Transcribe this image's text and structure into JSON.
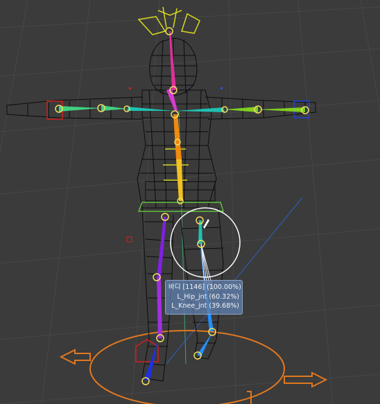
{
  "viewport": {
    "background": "#3b3b3b",
    "grid_color": "#4a4a4a",
    "mesh_color": "#0b0b0b"
  },
  "bone_colors": {
    "head": "#e0309a",
    "neck": "#d43cd0",
    "spine": "#f08a10",
    "spine_lower": "#f2c020",
    "arm_left": "#40d080",
    "arm_right": "#40d080",
    "shoulder": "#20c0b0",
    "leg_left": "#2090ff",
    "leg_right": "#8020e0",
    "foot_right": "#2030e0",
    "joint": "#f0e060"
  },
  "controls": {
    "head_ctrl_color": "#d8d820",
    "hand_left_ctrl_color": "#d02020",
    "hand_right_ctrl_color": "#2040e0",
    "hip_ctrl_color": "#60c040",
    "foot_ctrl_color": "#d02020",
    "root_ctrl_color": "#e07820"
  },
  "brush": {
    "color": "#ffffff"
  },
  "tooltip": {
    "line1": "바디 [1146] (100.00%)",
    "line2": "L_Hip_jnt (60.32%)",
    "line3": "L_Knee_jnt (39.68%)"
  }
}
